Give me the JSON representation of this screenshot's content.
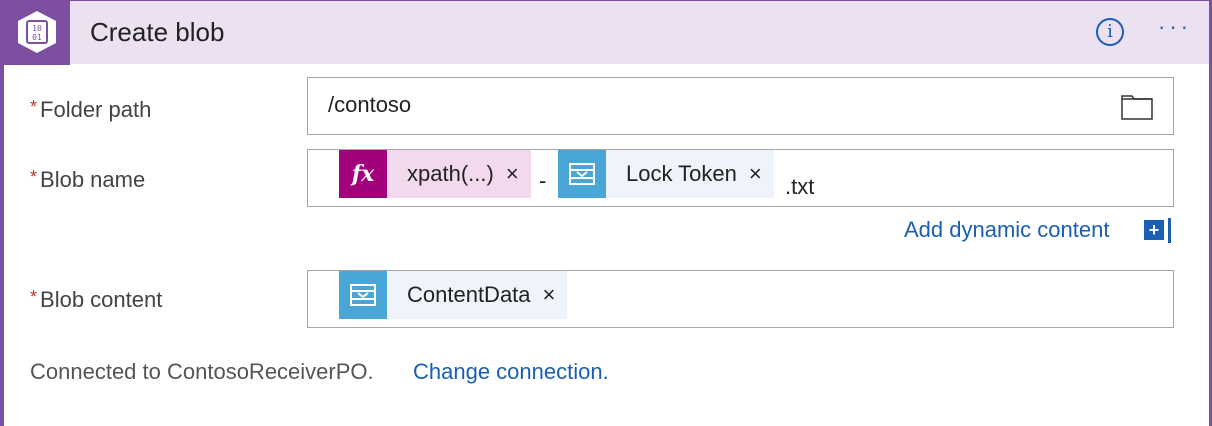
{
  "header": {
    "title": "Create blob",
    "info_glyph": "i",
    "more_glyph": "···",
    "accent_color": "#7e4fa0",
    "icon": "blob-storage-icon",
    "icon_text_top": "10",
    "icon_text_bottom": "01"
  },
  "fields": {
    "folder_path": {
      "required_mark": "*",
      "label": "Folder path",
      "value": "/contoso"
    },
    "blob_name": {
      "required_mark": "*",
      "label": "Blob name",
      "tokens": [
        {
          "label": "xpath(...)",
          "icon": "function-icon",
          "remove": "×"
        },
        {
          "label": "Lock Token",
          "icon": "service-bus-icon",
          "remove": "×"
        }
      ],
      "separator": "-",
      "suffix": ".txt"
    },
    "blob_content": {
      "required_mark": "*",
      "label": "Blob content",
      "tokens": [
        {
          "label": "ContentData",
          "icon": "service-bus-icon",
          "remove": "×"
        }
      ]
    }
  },
  "add_dynamic_content": {
    "label": "Add dynamic content",
    "plus": "+"
  },
  "footer": {
    "connected_text": "Connected to ContosoReceiverPO.",
    "change_link": "Change connection."
  }
}
